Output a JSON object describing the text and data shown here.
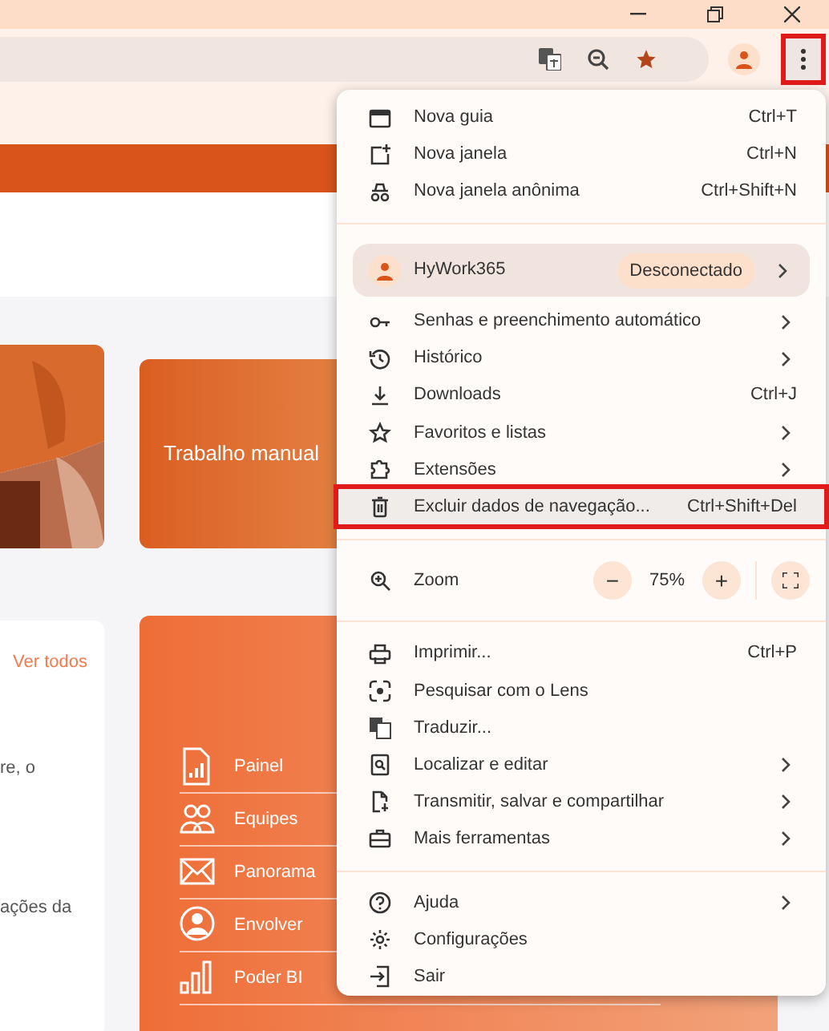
{
  "toolbar": {
    "menu_button_highlighted": true
  },
  "page": {
    "feature_card": {
      "title": "Trabalho manual"
    },
    "news_card": {
      "link": "Ver todos",
      "texts": [
        "re, o",
        "ações da"
      ]
    },
    "apps": [
      {
        "label": "Painel"
      },
      {
        "label": "Equipes"
      },
      {
        "label": "Panorama"
      },
      {
        "label": "Envolver"
      },
      {
        "label": "Poder BI"
      }
    ]
  },
  "menu": {
    "sections": [
      {
        "items": [
          {
            "kind": "item",
            "label": "Nova guia",
            "shortcut": "Ctrl+T",
            "submenu": false,
            "highlighted": false
          },
          {
            "kind": "item",
            "label": "Nova janela",
            "shortcut": "Ctrl+N",
            "submenu": false,
            "highlighted": false
          },
          {
            "kind": "item",
            "label": "Nova janela anônima",
            "shortcut": "Ctrl+Shift+N",
            "submenu": false,
            "highlighted": false
          }
        ]
      },
      {
        "items": [
          {
            "kind": "profile",
            "label": "HyWork365",
            "badge": "Desconectado",
            "submenu": true
          },
          {
            "kind": "item",
            "label": "Senhas e preenchimento automático",
            "submenu": true,
            "highlighted": false
          },
          {
            "kind": "item",
            "label": "Histórico",
            "submenu": true,
            "highlighted": false
          },
          {
            "kind": "item",
            "label": "Downloads",
            "shortcut": "Ctrl+J",
            "submenu": false,
            "highlighted": false
          },
          {
            "kind": "item",
            "label": "Favoritos e listas",
            "submenu": true,
            "highlighted": false
          },
          {
            "kind": "item",
            "label": "Extensões",
            "submenu": true,
            "highlighted": false
          },
          {
            "kind": "item",
            "label": "Excluir dados de navegação...",
            "shortcut": "Ctrl+Shift+Del",
            "submenu": false,
            "highlighted": true
          }
        ]
      },
      {
        "items": [
          {
            "kind": "zoom",
            "label": "Zoom",
            "minus": "−",
            "reading": "75%",
            "plus": "+"
          }
        ]
      },
      {
        "items": [
          {
            "kind": "item",
            "label": "Imprimir...",
            "shortcut": "Ctrl+P",
            "submenu": false,
            "highlighted": false
          },
          {
            "kind": "item",
            "label": "Pesquisar com o Lens",
            "submenu": false,
            "highlighted": false
          },
          {
            "kind": "item",
            "label": "Traduzir...",
            "submenu": false,
            "highlighted": false
          },
          {
            "kind": "item",
            "label": "Localizar e editar",
            "submenu": true,
            "highlighted": false
          },
          {
            "kind": "item",
            "label": "Transmitir, salvar e compartilhar",
            "submenu": true,
            "highlighted": false
          },
          {
            "kind": "item",
            "label": "Mais ferramentas",
            "submenu": true,
            "highlighted": false
          }
        ]
      },
      {
        "items": [
          {
            "kind": "item",
            "label": "Ajuda",
            "submenu": true,
            "highlighted": false
          },
          {
            "kind": "item",
            "label": "Configurações",
            "submenu": false,
            "highlighted": false
          },
          {
            "kind": "item",
            "label": "Sair",
            "submenu": false,
            "highlighted": false
          }
        ]
      }
    ]
  }
}
